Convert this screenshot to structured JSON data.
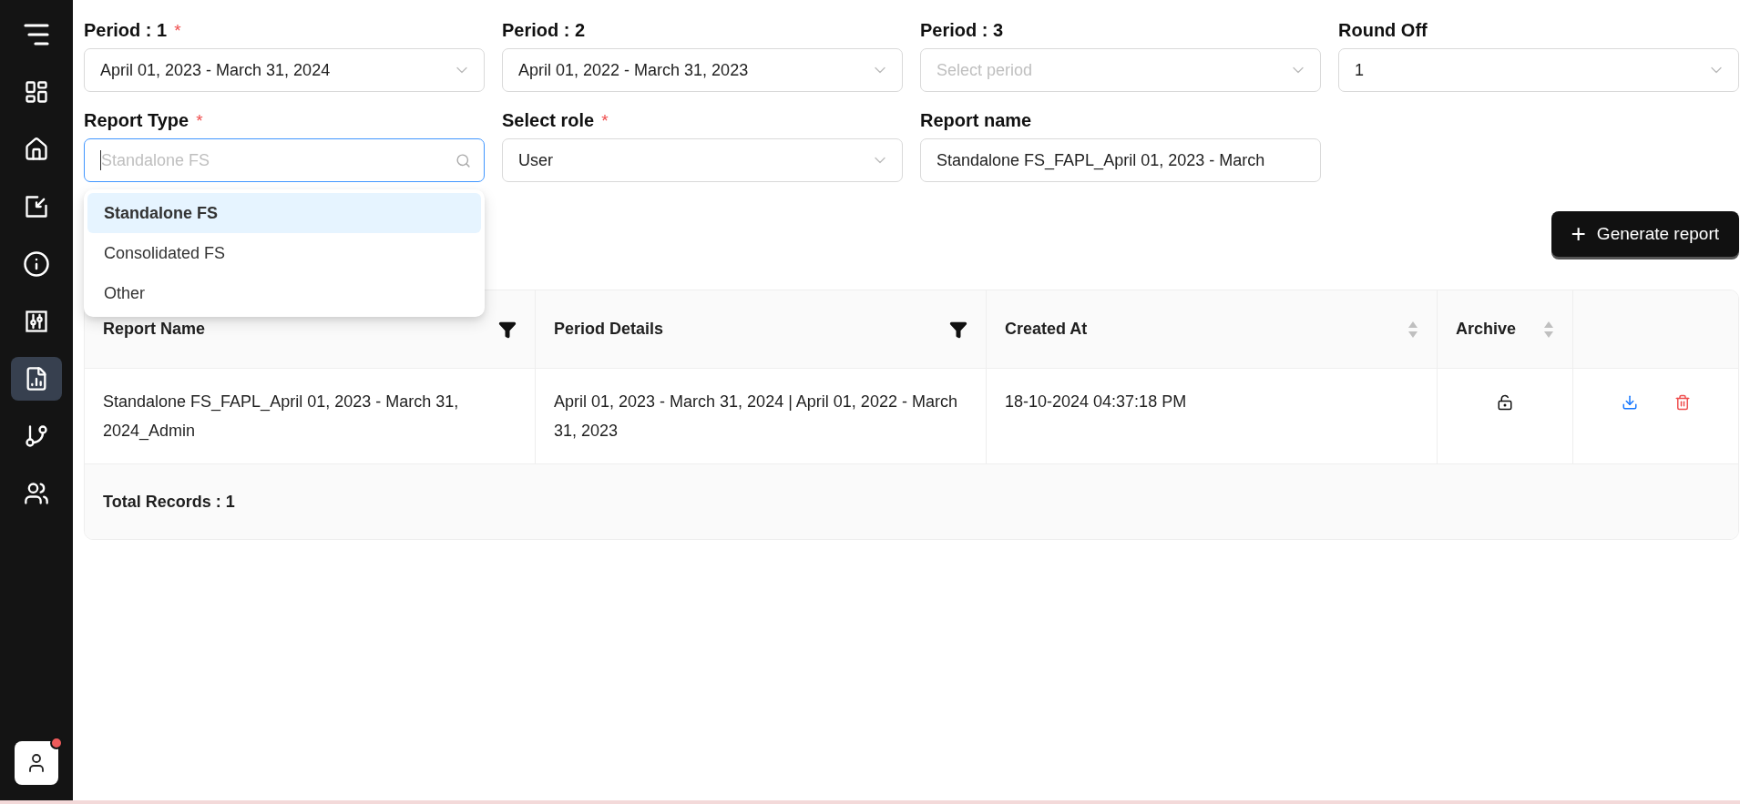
{
  "sidebar": {
    "items": [
      {
        "selected": false
      },
      {
        "selected": false
      },
      {
        "selected": false
      },
      {
        "selected": false
      },
      {
        "selected": false
      },
      {
        "selected": false
      },
      {
        "selected": true
      },
      {
        "selected": false
      },
      {
        "selected": false
      }
    ],
    "avatar": {
      "notification": true
    }
  },
  "form": {
    "fields": [
      {
        "kind": "select",
        "label": "Period : 1",
        "required_mark": "*",
        "value": "April 01, 2023 - March 31, 2024"
      },
      {
        "kind": "select",
        "label": "Period : 2",
        "value": "April 01, 2022 - March 31, 2023"
      },
      {
        "kind": "select",
        "label": "Period : 3",
        "placeholder": "Select period"
      },
      {
        "kind": "select",
        "label": "Round Off",
        "value": "1"
      },
      {
        "kind": "search",
        "label": "Report Type",
        "required_mark": "*",
        "placeholder": "Standalone FS",
        "focused": true
      },
      {
        "kind": "select",
        "label": "Select role",
        "required_mark": "*",
        "value": "User"
      },
      {
        "kind": "text",
        "label": "Report name",
        "value": "Standalone FS_FAPL_April 01, 2023 - March"
      }
    ],
    "dropdown": {
      "options": [
        {
          "label": "Standalone FS",
          "selected": true
        },
        {
          "label": "Consolidated FS",
          "selected": false
        },
        {
          "label": "Other",
          "selected": false
        }
      ]
    }
  },
  "generate_button": {
    "icon": "+",
    "label": "Generate report"
  },
  "table": {
    "columns": [
      {
        "label": "Report Name",
        "filter": true,
        "sortable": false
      },
      {
        "label": "Period Details",
        "filter": true,
        "sortable": false
      },
      {
        "label": "Created At",
        "filter": false,
        "sortable": true
      },
      {
        "label": "Archive",
        "filter": false,
        "sortable": true
      }
    ],
    "rows": [
      {
        "cells": [
          "Standalone FS_FAPL_April 01, 2023 - March 31, 2024_Admin",
          "April 01, 2023 - March 31, 2024 | April 01, 2022 - March 31, 2023",
          "18-10-2024 04:37:18 PM"
        ],
        "archived": false
      }
    ],
    "footer": "Total Records : 1"
  }
}
